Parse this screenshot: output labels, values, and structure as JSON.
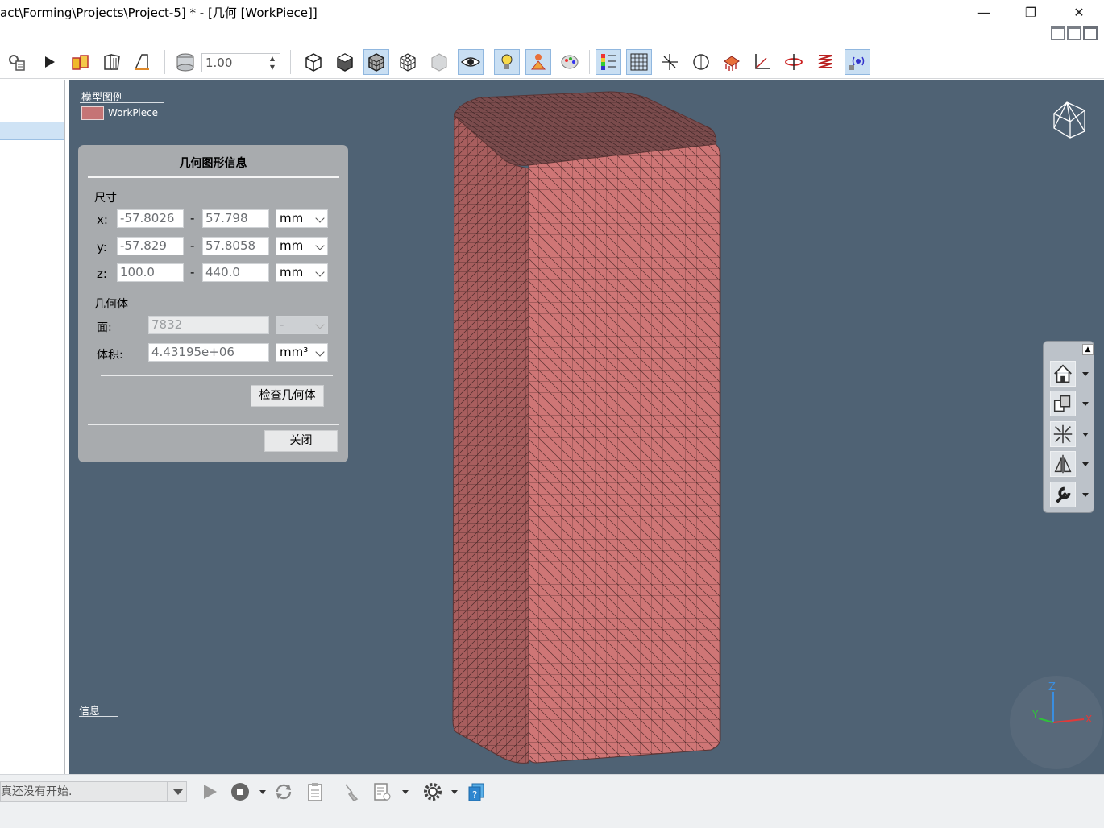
{
  "window": {
    "title": "act\\Forming\\Projects\\Project-5] * - [几何 [WorkPiece]]",
    "minimize": "—",
    "restore": "❐",
    "close": "✕"
  },
  "toolbar": {
    "zoom_value": "1.00"
  },
  "viewport": {
    "legend_title": "模型图例",
    "legend_item": "WorkPiece",
    "legend_color": "#c57475",
    "info_label": "信息",
    "background_color": "#4f6274",
    "triad_labels": {
      "z": "Z",
      "y": "Y",
      "x": "X"
    }
  },
  "dialog": {
    "title": "几何图形信息",
    "dims_section": "尺寸",
    "x": {
      "label": "x:",
      "min": "-57.8026",
      "max": "57.798",
      "unit": "mm"
    },
    "y": {
      "label": "y:",
      "min": "-57.829",
      "max": "57.8058",
      "unit": "mm"
    },
    "z": {
      "label": "z:",
      "min": "100.0",
      "max": "440.0",
      "unit": "mm"
    },
    "dash": "-",
    "geom_section": "几何体",
    "faces_label": "面:",
    "faces_value": "7832",
    "faces_unit": "-",
    "volume_label": "体积:",
    "volume_value": "4.43195e+06",
    "volume_unit": "mm³",
    "check_button": "检查几何体",
    "close_button": "关闭"
  },
  "statusbar": {
    "status_text": "真还没有开始."
  }
}
